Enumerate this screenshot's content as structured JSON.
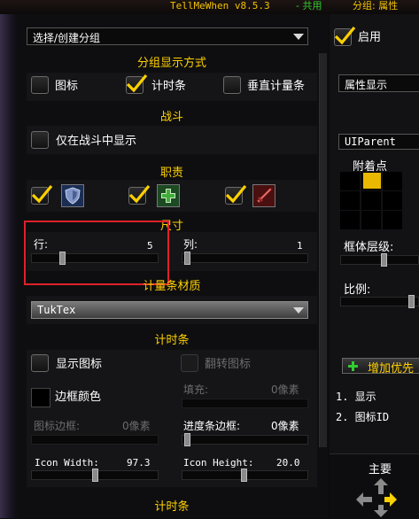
{
  "window": {
    "title": "TellMeWhen v8.5.3",
    "separator": "-",
    "shared": "共用",
    "group_label": "分组: 属性"
  },
  "top": {
    "group_dropdown": "选择/创建分组",
    "enabled_label": "启用"
  },
  "group_display": {
    "header": "分组显示方式",
    "options": [
      {
        "label": "图标",
        "checked": false
      },
      {
        "label": "计时条",
        "checked": true
      },
      {
        "label": "垂直计量条",
        "checked": false
      }
    ]
  },
  "combat": {
    "header": "战斗",
    "only_in_combat": "仅在战斗中显示"
  },
  "roles": {
    "header": "职责",
    "items": [
      {
        "icon": "shield-tank-icon",
        "checked": true
      },
      {
        "icon": "cross-healer-icon",
        "checked": true
      },
      {
        "icon": "sword-damage-icon",
        "checked": true
      }
    ]
  },
  "size": {
    "header": "尺寸",
    "rows_label": "行:",
    "rows_value": "5",
    "cols_label": "列:",
    "cols_value": "1"
  },
  "bar_texture": {
    "header": "计量条材质",
    "value": "TukTex"
  },
  "timer_bar": {
    "header": "计时条",
    "show_icon": "显示图标",
    "flip_icon": "翻转图标",
    "border_color": "边框颜色",
    "padding_label": "填充:",
    "padding_value": "0像素",
    "icon_border_label": "图标边框:",
    "icon_border_value": "0像素",
    "progress_border_label": "进度条边框:",
    "progress_border_value": "0像素",
    "icon_width_label": "Icon Width:",
    "icon_width_value": "97.3",
    "icon_height_label": "Icon Height:",
    "icon_height_value": "20.0"
  },
  "timer_bar_2": {
    "header": "计时条"
  },
  "right": {
    "attr_dropdown": "属性显示",
    "parent_value": "UIParent",
    "anchor_label": "附着点",
    "frame_level_label": "框体层级:",
    "scale_label": "比例:",
    "add_priority": "增加优先",
    "list_items": [
      "1. 显示",
      "2. 图标ID"
    ],
    "main_label": "主要"
  },
  "colors": {
    "accent_gold": "#ffd100",
    "highlight_red": "#e0202a",
    "shared_green": "#33cc33",
    "anchor_selected": "#e8b900"
  }
}
